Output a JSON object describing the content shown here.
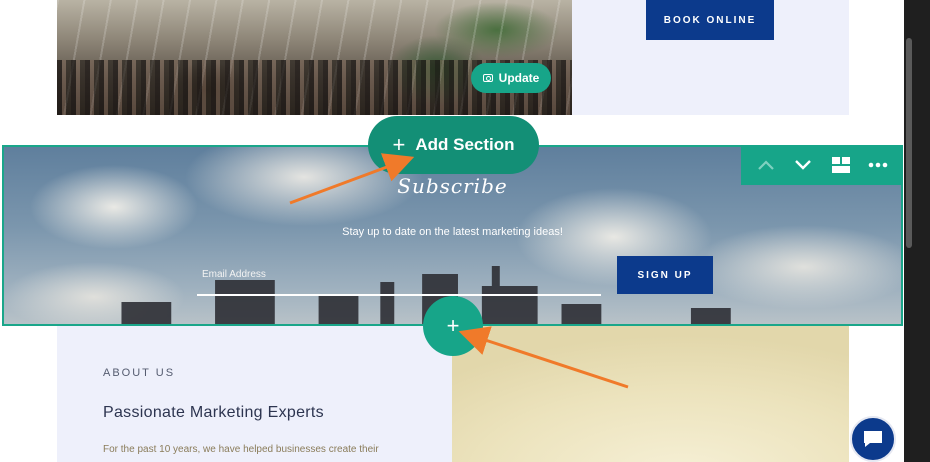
{
  "top_section": {
    "update_label": "Update",
    "book_label": "BOOK ONLINE"
  },
  "subscribe_section": {
    "title": "Subscribe",
    "subtitle": "Stay up to date on the latest marketing ideas!",
    "email_placeholder": "Email Address",
    "signup_label": "SIGN UP"
  },
  "editor": {
    "add_section_label": "Add Section",
    "toolbar": [
      "chevron-up-icon",
      "chevron-down-icon",
      "layout-icon",
      "more-icon"
    ]
  },
  "about_section": {
    "kicker": "ABOUT US",
    "title": "Passionate Marketing Experts",
    "text": "For the past 10 years, we have helped businesses create their"
  },
  "colors": {
    "accent": "#17a589",
    "brand": "#0c3a8c",
    "annotation_arrow": "#f07a2a"
  }
}
